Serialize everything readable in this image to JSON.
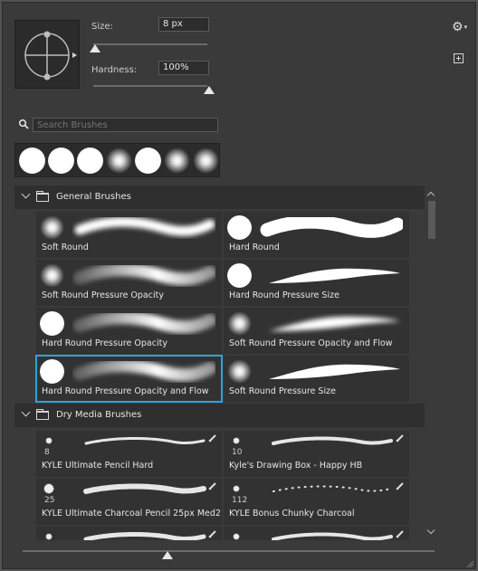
{
  "brush_settings": {
    "size_label": "Size:",
    "size_value": "8 px",
    "size_fraction": 0.0,
    "hardness_label": "Hardness:",
    "hardness_value": "100%",
    "hardness_fraction": 1.0
  },
  "header_icons": {
    "settings": "gear-icon",
    "new_preset": "new-preset-icon"
  },
  "search": {
    "placeholder": "Search Brushes"
  },
  "recent_brushes": [
    "hard",
    "hard",
    "hard",
    "soft",
    "hard",
    "soft",
    "soft"
  ],
  "groups": [
    {
      "name": "General Brushes",
      "brushes": [
        {
          "name": "Soft Round",
          "tip": "soft",
          "stroke": "soft"
        },
        {
          "name": "Hard Round",
          "tip": "hard",
          "stroke": "hard"
        },
        {
          "name": "Soft Round Pressure Opacity",
          "tip": "soft",
          "stroke": "soft-fade"
        },
        {
          "name": "Hard Round Pressure Size",
          "tip": "hard",
          "stroke": "taper"
        },
        {
          "name": "Hard Round Pressure Opacity",
          "tip": "hard",
          "stroke": "soft-fade"
        },
        {
          "name": "Soft Round Pressure Opacity and Flow",
          "tip": "soft",
          "stroke": "soft-taper"
        },
        {
          "name": "Hard Round Pressure Opacity and Flow",
          "tip": "hard",
          "stroke": "soft-fade",
          "selected": true
        },
        {
          "name": "Soft Round Pressure Size",
          "tip": "soft",
          "stroke": "taper"
        }
      ]
    },
    {
      "name": "Dry Media Brushes",
      "brushes": [
        {
          "name": "KYLE Ultimate Pencil Hard",
          "size": "8"
        },
        {
          "name": "Kyle's Drawing Box - Happy HB",
          "size": "10"
        },
        {
          "name": "KYLE Ultimate Charcoal Pencil 25px Med2",
          "size": "25"
        },
        {
          "name": "KYLE Bonus Chunky Charcoal",
          "size": "112"
        },
        {
          "name": "",
          "size": ""
        },
        {
          "name": "",
          "size": ""
        }
      ]
    }
  ]
}
